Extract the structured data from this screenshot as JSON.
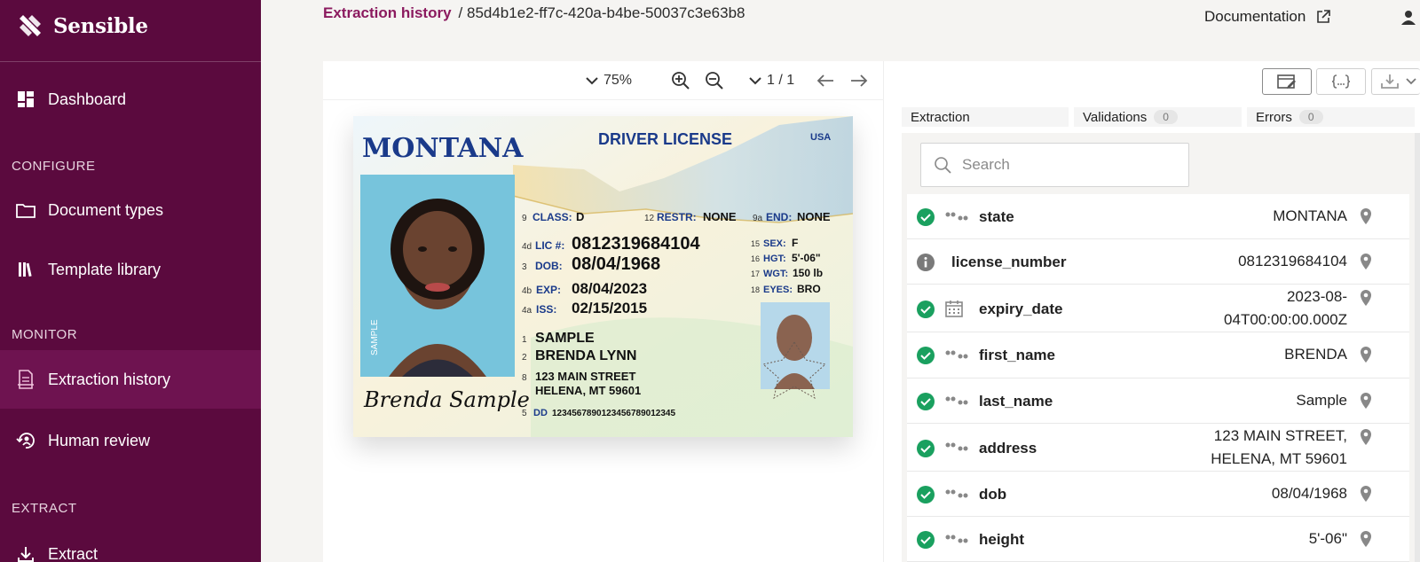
{
  "app": {
    "name": "Sensible"
  },
  "sidebar": {
    "dashboard": "Dashboard",
    "section_configure": "CONFIGURE",
    "document_types": "Document types",
    "template_library": "Template library",
    "section_monitor": "MONITOR",
    "extraction_history": "Extraction history",
    "human_review": "Human review",
    "section_extract": "EXTRACT",
    "extract": "Extract"
  },
  "header": {
    "breadcrumb_link": "Extraction history",
    "breadcrumb_id": "/ 85d4b1e2-ff7c-420a-b4be-50037c3e63b8",
    "documentation": "Documentation"
  },
  "viewer": {
    "zoom": "75%",
    "page": "1 / 1"
  },
  "card": {
    "state": "MONTANA",
    "title": "DRIVER LICENSE",
    "country": "USA",
    "class_label": "CLASS:",
    "class": "D",
    "restr_label": "RESTR:",
    "restr": "NONE",
    "end_label": "END:",
    "end": "NONE",
    "lic_label": "LIC #:",
    "lic": "0812319684104",
    "dob_label": "DOB:",
    "dob": "08/04/1968",
    "exp_label": "EXP:",
    "exp": "08/04/2023",
    "iss_label": "ISS:",
    "iss": "02/15/2015",
    "sex_label": "SEX:",
    "sex": "F",
    "hgt_label": "HGT:",
    "hgt": "5'-06\"",
    "wgt_label": "WGT:",
    "wgt": "150 lb",
    "eyes_label": "EYES:",
    "eyes": "BRO",
    "name1": "SAMPLE",
    "name2": "BRENDA LYNN",
    "addr1": "123 MAIN STREET",
    "addr2": "HELENA, MT 59601",
    "dd_label": "DD",
    "dd": "1234567890123456789012345",
    "signature": "Brenda Sample",
    "sample_tag": "SAMPLE",
    "num_9": "9",
    "num_12": "12",
    "num_9a": "9a",
    "num_4d": "4d",
    "num_3": "3",
    "num_4b": "4b",
    "num_4a": "4a",
    "num_15": "15",
    "num_16": "16",
    "num_17": "17",
    "num_18": "18",
    "num_1": "1",
    "num_2": "2",
    "num_8": "8",
    "num_5": "5"
  },
  "tabs": {
    "extraction": "Extraction",
    "validations": "Validations",
    "validations_count": "0",
    "errors": "Errors",
    "errors_count": "0"
  },
  "search": {
    "placeholder": "Search"
  },
  "fields": [
    {
      "name": "state",
      "value": "MONTANA",
      "status": "ok",
      "type": "string"
    },
    {
      "name": "license_number",
      "value": "0812319684104",
      "status": "info",
      "type": "none"
    },
    {
      "name": "expiry_date",
      "value_line1": "2023-08-",
      "value_line2": "04T00:00:00.000Z",
      "status": "ok",
      "type": "date"
    },
    {
      "name": "first_name",
      "value": "BRENDA",
      "status": "ok",
      "type": "string"
    },
    {
      "name": "last_name",
      "value": "Sample",
      "status": "ok",
      "type": "string"
    },
    {
      "name": "address",
      "value_line1": "123 MAIN STREET,",
      "value_line2": "HELENA, MT 59601",
      "status": "ok",
      "type": "string"
    },
    {
      "name": "dob",
      "value": "08/04/1968",
      "status": "ok",
      "type": "string"
    },
    {
      "name": "height",
      "value": "5'-06\"",
      "status": "ok",
      "type": "string"
    }
  ],
  "colors": {
    "sidebar": "#5b0a3e",
    "sidebar_active": "#6e1350",
    "accent": "#8b1a5f",
    "success": "#1aa05f",
    "info": "#7a7a7a"
  }
}
